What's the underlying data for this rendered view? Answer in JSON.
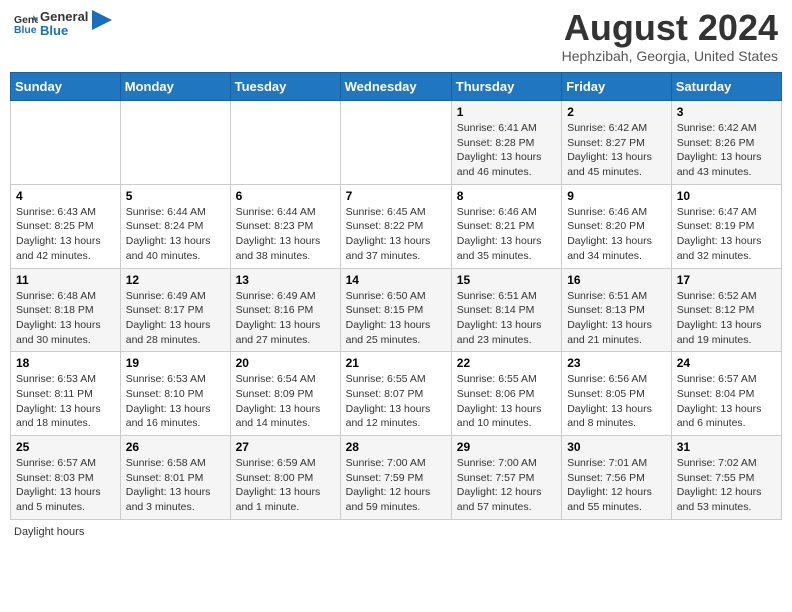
{
  "header": {
    "logo_general": "General",
    "logo_blue": "Blue",
    "month_year": "August 2024",
    "location": "Hephzibah, Georgia, United States"
  },
  "calendar": {
    "days_of_week": [
      "Sunday",
      "Monday",
      "Tuesday",
      "Wednesday",
      "Thursday",
      "Friday",
      "Saturday"
    ],
    "weeks": [
      [
        {
          "day": "",
          "info": ""
        },
        {
          "day": "",
          "info": ""
        },
        {
          "day": "",
          "info": ""
        },
        {
          "day": "",
          "info": ""
        },
        {
          "day": "1",
          "info": "Sunrise: 6:41 AM\nSunset: 8:28 PM\nDaylight: 13 hours and 46 minutes."
        },
        {
          "day": "2",
          "info": "Sunrise: 6:42 AM\nSunset: 8:27 PM\nDaylight: 13 hours and 45 minutes."
        },
        {
          "day": "3",
          "info": "Sunrise: 6:42 AM\nSunset: 8:26 PM\nDaylight: 13 hours and 43 minutes."
        }
      ],
      [
        {
          "day": "4",
          "info": "Sunrise: 6:43 AM\nSunset: 8:25 PM\nDaylight: 13 hours and 42 minutes."
        },
        {
          "day": "5",
          "info": "Sunrise: 6:44 AM\nSunset: 8:24 PM\nDaylight: 13 hours and 40 minutes."
        },
        {
          "day": "6",
          "info": "Sunrise: 6:44 AM\nSunset: 8:23 PM\nDaylight: 13 hours and 38 minutes."
        },
        {
          "day": "7",
          "info": "Sunrise: 6:45 AM\nSunset: 8:22 PM\nDaylight: 13 hours and 37 minutes."
        },
        {
          "day": "8",
          "info": "Sunrise: 6:46 AM\nSunset: 8:21 PM\nDaylight: 13 hours and 35 minutes."
        },
        {
          "day": "9",
          "info": "Sunrise: 6:46 AM\nSunset: 8:20 PM\nDaylight: 13 hours and 34 minutes."
        },
        {
          "day": "10",
          "info": "Sunrise: 6:47 AM\nSunset: 8:19 PM\nDaylight: 13 hours and 32 minutes."
        }
      ],
      [
        {
          "day": "11",
          "info": "Sunrise: 6:48 AM\nSunset: 8:18 PM\nDaylight: 13 hours and 30 minutes."
        },
        {
          "day": "12",
          "info": "Sunrise: 6:49 AM\nSunset: 8:17 PM\nDaylight: 13 hours and 28 minutes."
        },
        {
          "day": "13",
          "info": "Sunrise: 6:49 AM\nSunset: 8:16 PM\nDaylight: 13 hours and 27 minutes."
        },
        {
          "day": "14",
          "info": "Sunrise: 6:50 AM\nSunset: 8:15 PM\nDaylight: 13 hours and 25 minutes."
        },
        {
          "day": "15",
          "info": "Sunrise: 6:51 AM\nSunset: 8:14 PM\nDaylight: 13 hours and 23 minutes."
        },
        {
          "day": "16",
          "info": "Sunrise: 6:51 AM\nSunset: 8:13 PM\nDaylight: 13 hours and 21 minutes."
        },
        {
          "day": "17",
          "info": "Sunrise: 6:52 AM\nSunset: 8:12 PM\nDaylight: 13 hours and 19 minutes."
        }
      ],
      [
        {
          "day": "18",
          "info": "Sunrise: 6:53 AM\nSunset: 8:11 PM\nDaylight: 13 hours and 18 minutes."
        },
        {
          "day": "19",
          "info": "Sunrise: 6:53 AM\nSunset: 8:10 PM\nDaylight: 13 hours and 16 minutes."
        },
        {
          "day": "20",
          "info": "Sunrise: 6:54 AM\nSunset: 8:09 PM\nDaylight: 13 hours and 14 minutes."
        },
        {
          "day": "21",
          "info": "Sunrise: 6:55 AM\nSunset: 8:07 PM\nDaylight: 13 hours and 12 minutes."
        },
        {
          "day": "22",
          "info": "Sunrise: 6:55 AM\nSunset: 8:06 PM\nDaylight: 13 hours and 10 minutes."
        },
        {
          "day": "23",
          "info": "Sunrise: 6:56 AM\nSunset: 8:05 PM\nDaylight: 13 hours and 8 minutes."
        },
        {
          "day": "24",
          "info": "Sunrise: 6:57 AM\nSunset: 8:04 PM\nDaylight: 13 hours and 6 minutes."
        }
      ],
      [
        {
          "day": "25",
          "info": "Sunrise: 6:57 AM\nSunset: 8:03 PM\nDaylight: 13 hours and 5 minutes."
        },
        {
          "day": "26",
          "info": "Sunrise: 6:58 AM\nSunset: 8:01 PM\nDaylight: 13 hours and 3 minutes."
        },
        {
          "day": "27",
          "info": "Sunrise: 6:59 AM\nSunset: 8:00 PM\nDaylight: 13 hours and 1 minute."
        },
        {
          "day": "28",
          "info": "Sunrise: 7:00 AM\nSunset: 7:59 PM\nDaylight: 12 hours and 59 minutes."
        },
        {
          "day": "29",
          "info": "Sunrise: 7:00 AM\nSunset: 7:57 PM\nDaylight: 12 hours and 57 minutes."
        },
        {
          "day": "30",
          "info": "Sunrise: 7:01 AM\nSunset: 7:56 PM\nDaylight: 12 hours and 55 minutes."
        },
        {
          "day": "31",
          "info": "Sunrise: 7:02 AM\nSunset: 7:55 PM\nDaylight: 12 hours and 53 minutes."
        }
      ]
    ]
  },
  "footer": {
    "label": "Daylight hours"
  }
}
